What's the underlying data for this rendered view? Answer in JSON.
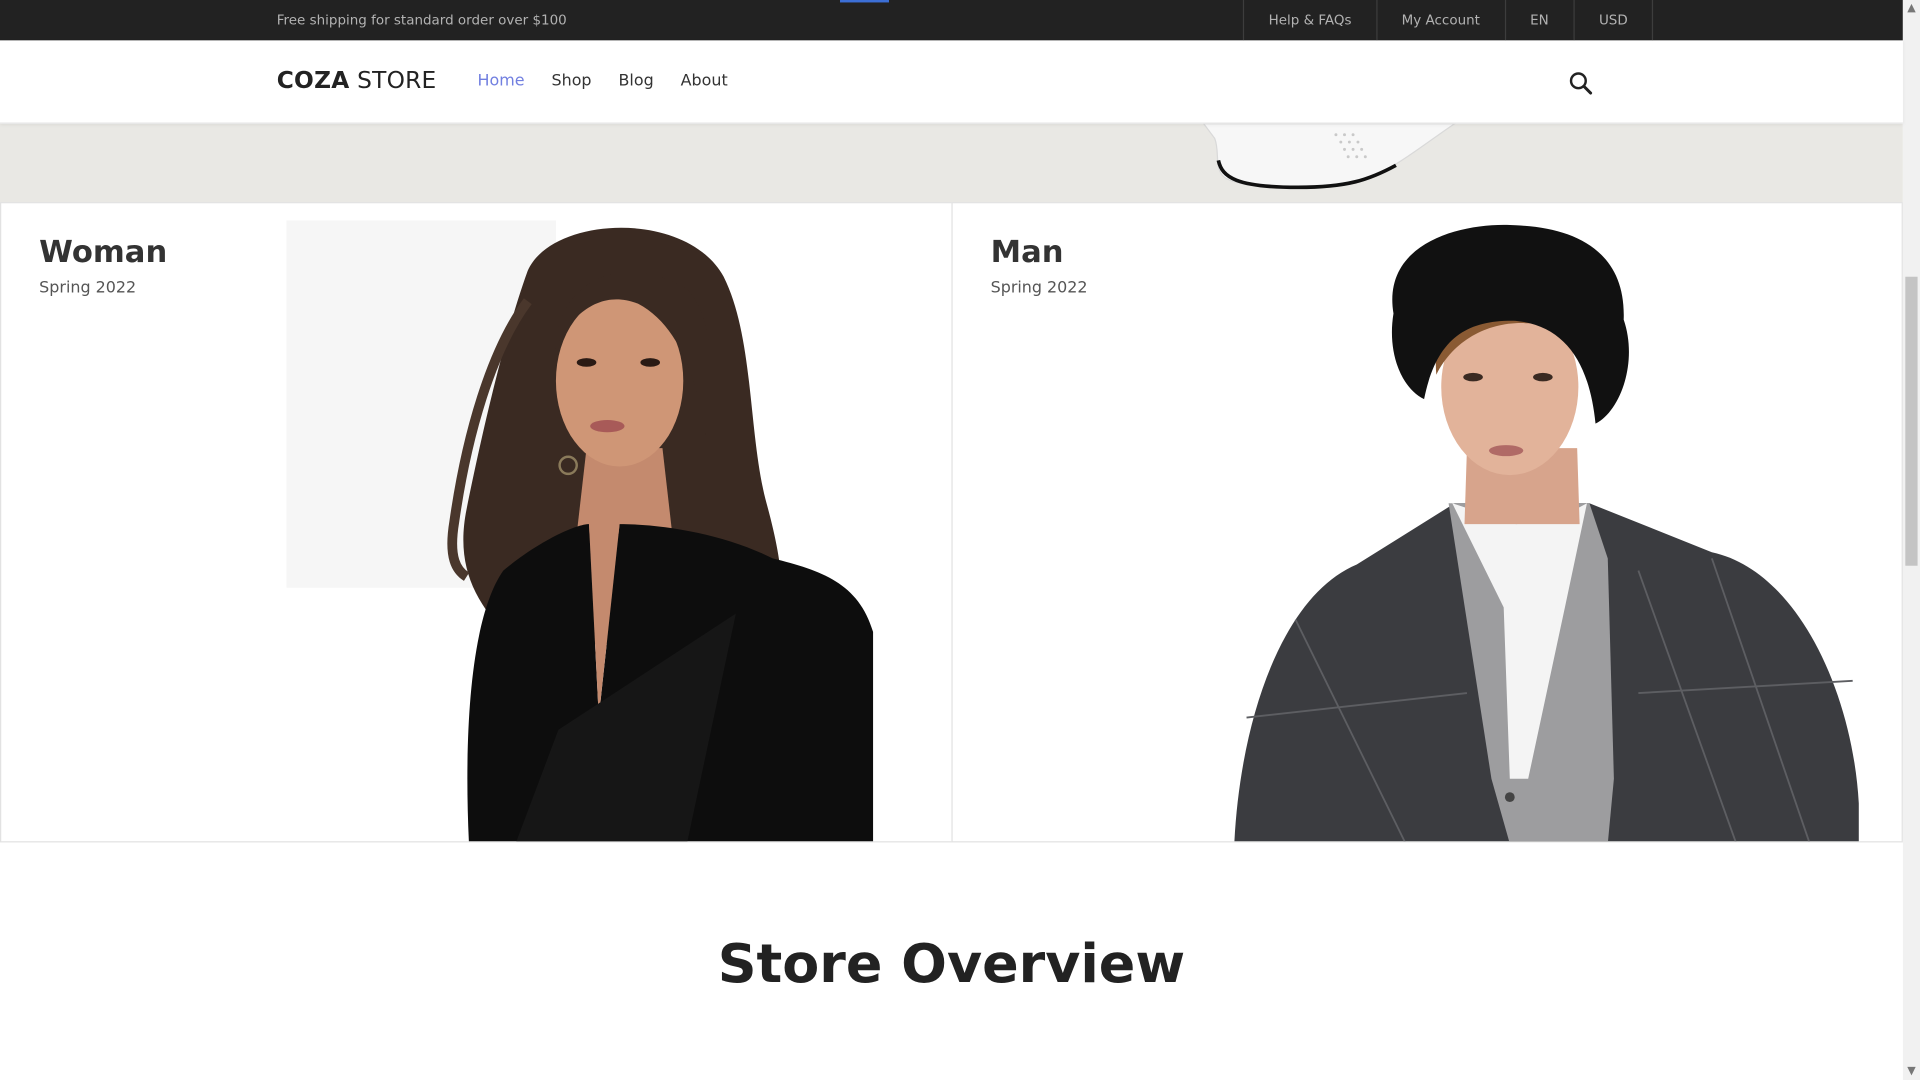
{
  "topbar": {
    "shipping_text": "Free shipping for standard order over $100",
    "links": [
      "Help & FAQs",
      "My Account",
      "EN",
      "USD"
    ]
  },
  "header": {
    "logo_bold": "COZA",
    "logo_light": " STORE",
    "nav": [
      "Home",
      "Shop",
      "Blog",
      "About"
    ],
    "active_nav": "Home",
    "search_icon": "search-icon"
  },
  "banners": [
    {
      "title": "Woman",
      "subtitle": "Spring 2022"
    },
    {
      "title": "Man",
      "subtitle": "Spring 2022"
    }
  ],
  "section": {
    "title": "Store Overview"
  },
  "colors": {
    "topbar_bg": "#222222",
    "accent": "#717fe0",
    "hero_bg": "#e9e8e4"
  }
}
